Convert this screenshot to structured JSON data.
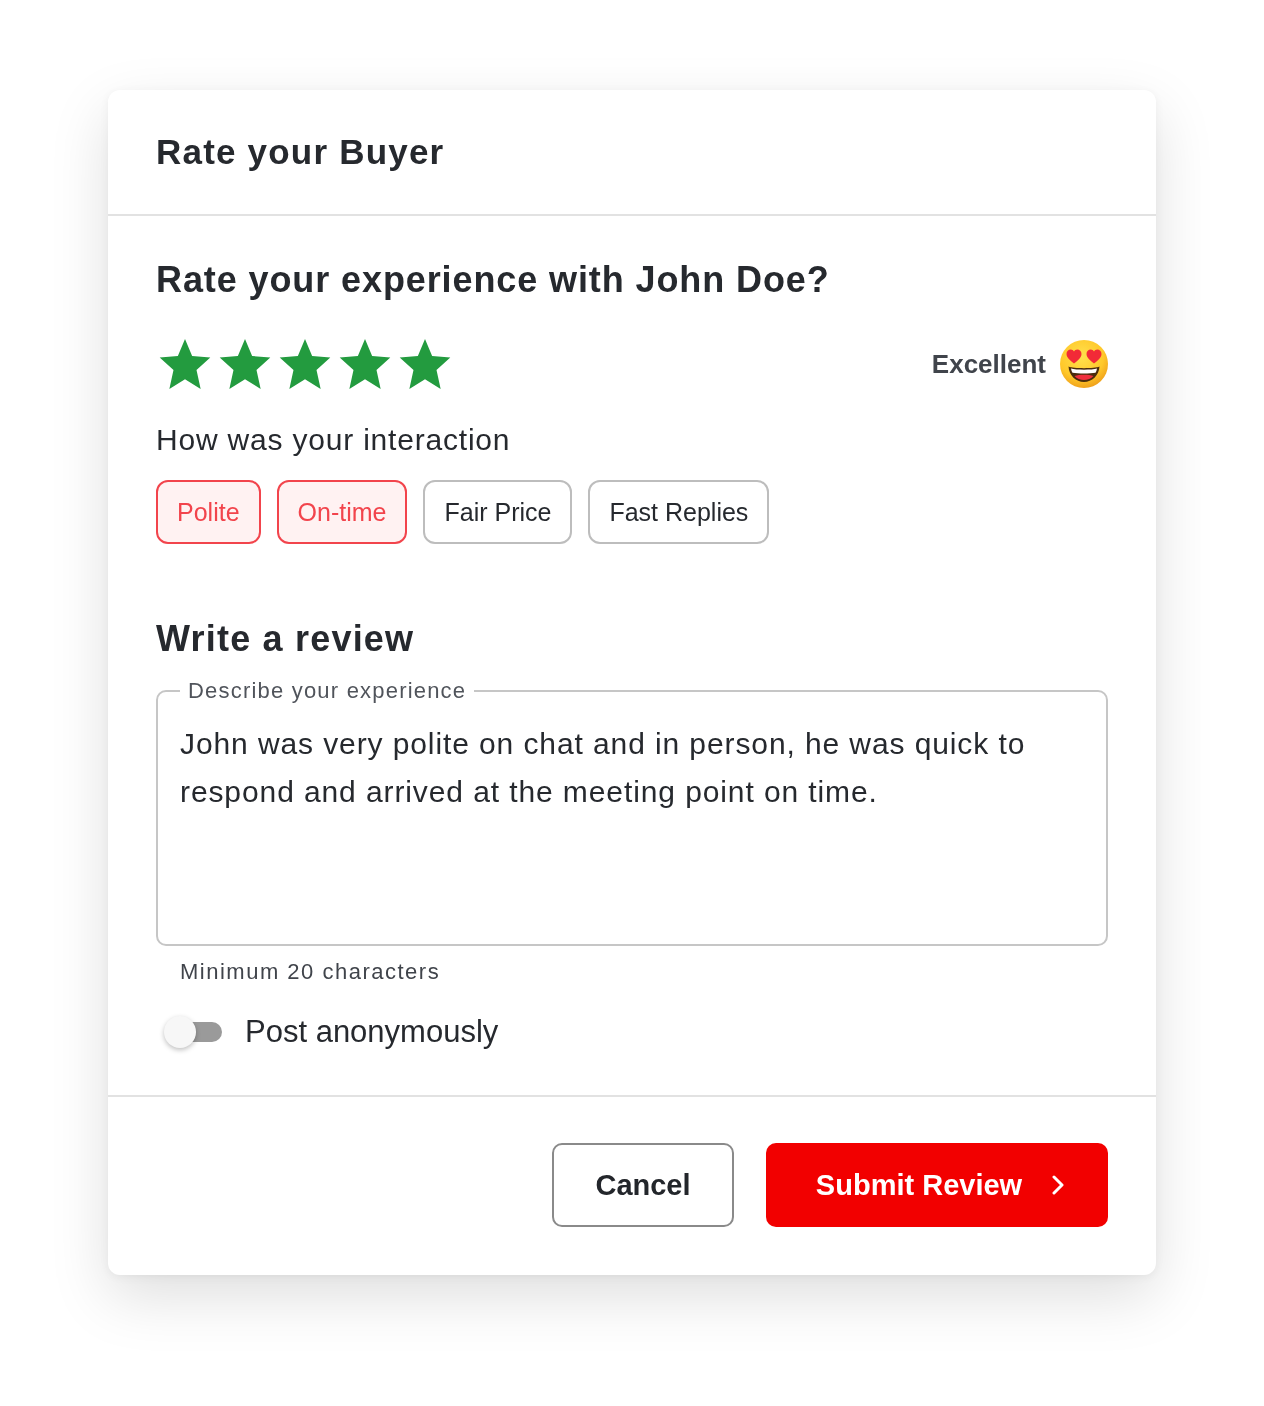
{
  "dialog": {
    "title": "Rate your Buyer"
  },
  "rating": {
    "question": "Rate your experience with John Doe?",
    "stars": 5,
    "verdict": "Excellent"
  },
  "interaction": {
    "label": "How was your interaction",
    "tags": [
      {
        "label": "Polite",
        "selected": true
      },
      {
        "label": "On-time",
        "selected": true
      },
      {
        "label": "Fair Price",
        "selected": false
      },
      {
        "label": "Fast Replies",
        "selected": false
      }
    ]
  },
  "review": {
    "heading": "Write a review",
    "field": {
      "label": "Describe your experience",
      "value": "John was very polite on chat and in person, he was quick to respond and arrived at the meeting point on time."
    },
    "hint": "Minimum 20 characters"
  },
  "anonymous": {
    "label": "Post anonymously",
    "on": false
  },
  "buttons": [
    {
      "label": "Cancel",
      "kind": "secondary"
    },
    {
      "label": "Submit Review",
      "kind": "primary"
    }
  ]
}
